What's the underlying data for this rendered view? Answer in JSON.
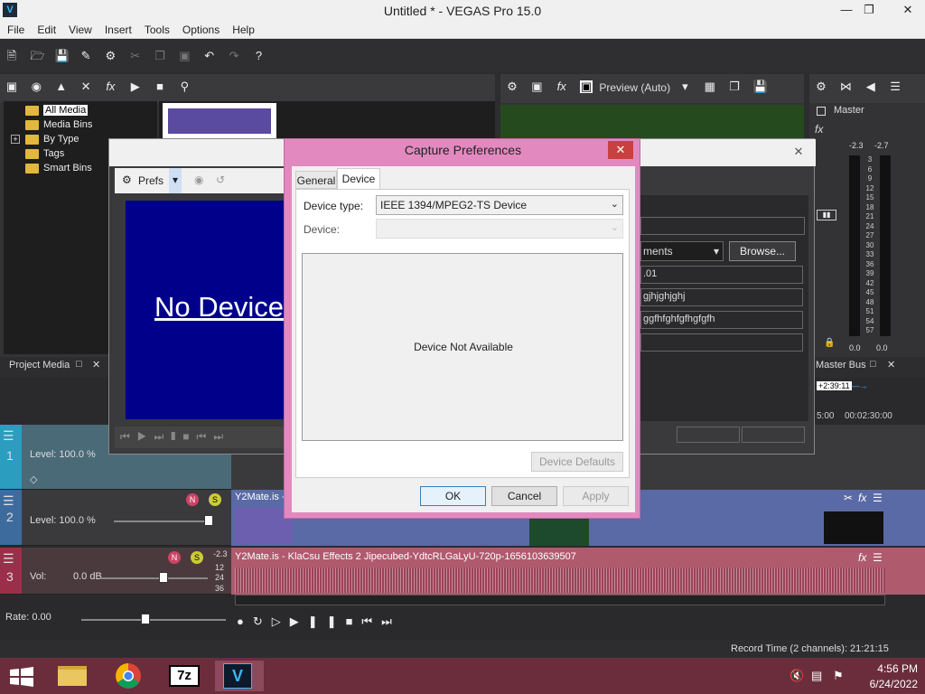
{
  "window": {
    "title": "Untitled * - VEGAS Pro 15.0",
    "logo": "V",
    "controls": [
      "minimize-icon",
      "restore-icon",
      "close-icon"
    ]
  },
  "menu": [
    "File",
    "Edit",
    "View",
    "Insert",
    "Tools",
    "Options",
    "Help"
  ],
  "media_tree": {
    "items": [
      "All Media",
      "Media Bins",
      "By Type",
      "Tags",
      "Smart Bins"
    ],
    "expander": "+"
  },
  "preview": {
    "label": "Preview (Auto)"
  },
  "master": {
    "label": "Master",
    "peak_left": "-2.3",
    "peak_right": "-2.7",
    "scale": [
      "3",
      "6",
      "9",
      "12",
      "15",
      "18",
      "21",
      "24",
      "27",
      "30",
      "33",
      "36",
      "39",
      "42",
      "45",
      "48",
      "51",
      "54",
      "57"
    ],
    "bottom_left": "0.0",
    "bottom_right": "0.0"
  },
  "tabs": {
    "project_media": "Project Media",
    "master_bus": "Master Bus"
  },
  "timeline": {
    "cursor_time": "+2:39:11",
    "ruler_labels": [
      "5:00",
      "00:02:30:00"
    ]
  },
  "tracks": [
    {
      "num": "1",
      "level_label": "Level: 100.0 %"
    },
    {
      "num": "2",
      "level_label": "Level: 100.0 %",
      "clip_title": "Y2Mate.is -"
    },
    {
      "num": "3",
      "vol_label": "Vol:",
      "vol_value": "0.0 dB",
      "meter_values": [
        "-2.3",
        "12",
        "24",
        "36"
      ],
      "clip_title": "Y2Mate.is - KlaCsu Effects 2 Jipecubed-YdtcRLGaLyU-720p-1656103639507"
    }
  ],
  "rate": "Rate: 0.00",
  "record_time": "Record Time (2 channels): 21:21:15",
  "capture_window": {
    "prefs_label": "Prefs",
    "no_device_text": "No Device",
    "browse_label": "Browse...",
    "field_fragments": [
      "ments",
      ".01",
      "gjhjghjghj",
      "ggfhfghfgfhgfgfh",
      ""
    ]
  },
  "capture_prefs": {
    "title": "Capture Preferences",
    "tabs": [
      "General",
      "Device"
    ],
    "active_tab": "Device",
    "device_type_label": "Device type:",
    "device_type_value": "IEEE 1394/MPEG2-TS Device",
    "device_label": "Device:",
    "device_value": "",
    "status": "Device Not Available",
    "device_defaults": "Device Defaults",
    "ok": "OK",
    "cancel": "Cancel",
    "apply": "Apply"
  },
  "taskbar": {
    "time": "4:56 PM",
    "date": "6/24/2022",
    "apps": [
      "file-explorer-icon",
      "chrome-icon",
      "7zip-icon",
      "vegas-icon"
    ],
    "seven_zip": "7z",
    "vegas": "V"
  }
}
